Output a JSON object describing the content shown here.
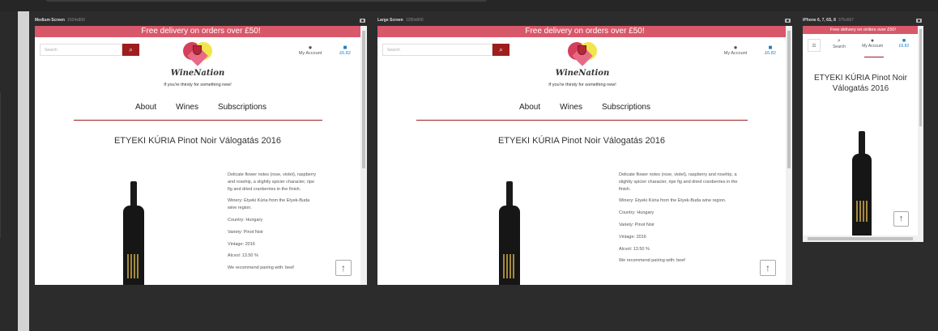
{
  "devices": [
    {
      "name": "Medium Screen",
      "size": "1024x800"
    },
    {
      "name": "Large Screen",
      "size": "1280x800"
    },
    {
      "name": "iPhone 6, 7, 6S, 8",
      "size": "375x667"
    }
  ],
  "site": {
    "promo": "Free delivery on orders over £50!",
    "search_placeholder": "Search",
    "brand": "WineNation",
    "tagline": "If you're thirsty for something new!",
    "nav": [
      "About",
      "Wines",
      "Subscriptions"
    ],
    "account_label": "My Account",
    "search_label": "Search",
    "bag_total": "£6.82"
  },
  "product": {
    "title": "ETYEKI KÚRIA Pinot Noir Válogatás 2016",
    "description": "Delicate flower notes (rose, violet), raspberry and rosehip, a slightly spicier character, ripe fig and dried cranberries in the finish.",
    "winery": "Winery: Etyeki Kúria from the Etyek-Buda wine region.",
    "country": "Country: Hungary",
    "variety": "Variety: Pinot Noir",
    "vintage": "Vintage: 2016",
    "alcohol": "Alcvol: 13.50 %",
    "pairing": "We recommend pairing with: beef"
  },
  "icons": {
    "search": "search-icon",
    "account": "user-icon",
    "bag": "shopping-bag-icon",
    "up": "arrow-up-icon",
    "menu": "hamburger-icon",
    "camera": "camera-icon"
  },
  "colors": {
    "promo": "#d9576a",
    "search_button": "#9e1d1d",
    "rule": "#9b1d1d",
    "bag": "#1c7fc4"
  }
}
